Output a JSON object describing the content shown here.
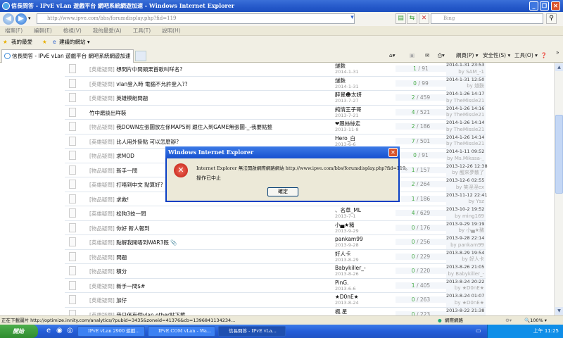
{
  "window": {
    "title": "信長問答 - IPvE vLan 遊戲平台 網吧系統網遊加速 - Windows Internet Explorer"
  },
  "address": {
    "url": "http://www.ipve.com/bbs/forumdisplay.php?fid=119",
    "search_placeholder": "Bing"
  },
  "menu": [
    "檔案(F)",
    "編輯(E)",
    "檢視(V)",
    "我的最愛(A)",
    "工具(T)",
    "說明(H)"
  ],
  "favorites": {
    "label": "我的最愛",
    "suggested": "建議的網站 ▾"
  },
  "tab": {
    "label": "信長問答 - IPvE vLan 遊戲平台 網吧系統網遊加速"
  },
  "commandbar": {
    "page": "網頁(P) ▾",
    "safety": "安全性(S) ▾",
    "tools": "工具(O) ▾"
  },
  "threads": [
    {
      "tag": "[英雄疑問]",
      "title": "想問片中間頭果首歌叫咩名?",
      "author": "燧麩",
      "date": "2014-1-31",
      "replies": "1",
      "views": "/ 91",
      "last_time": "2014-1-31 23:53",
      "last_by": "by SAM_-1"
    },
    {
      "tag": "[英雄疑問]",
      "title": "vlan登入時 電腦不允許登入??",
      "author": "燧麩",
      "date": "2014-1-31",
      "replies": "0",
      "views": "/ 99",
      "last_time": "2014-1-31 12:50",
      "last_by": "by 燧麩"
    },
    {
      "tag": "[英雄疑問]",
      "title": "英雄模組問題",
      "author": "醉覺☻太妍",
      "date": "2013-7-27",
      "replies": "2",
      "views": "/ 459",
      "last_time": "2014-1-26 14:17",
      "last_by": "by TheMissle21"
    },
    {
      "tag": "",
      "title": "竹中磨談出咩裝",
      "author": "純情王子哥",
      "date": "2013-7-21",
      "replies": "4",
      "views": "/ 521",
      "last_time": "2014-1-26 14:16",
      "last_by": "by TheMissle21"
    },
    {
      "tag": "[物品疑問]",
      "title": "我DOWN左張圖放左係MAPS到 跟住入到GAME無張圖-_-我要點整",
      "author": "❤跟絲絲走",
      "date": "2013-11-8",
      "replies": "2",
      "views": "/ 186",
      "last_time": "2014-1-26 14:14",
      "last_by": "by TheMissle21"
    },
    {
      "tag": "[英雄疑問]",
      "title": "比人用外掛點 可以怎麼辦?",
      "author": "Hero_白",
      "date": "2013-6-6",
      "replies": "7",
      "views": "/ 501",
      "last_time": "2014-1-26 14:14",
      "last_by": "by TheMissle21"
    },
    {
      "tag": "[物品疑問]",
      "title": "求MOD",
      "author": "",
      "date": "",
      "replies": "0",
      "views": "/ 91",
      "last_time": "2014-1-11 09:52",
      "last_by": "by Ms.Mikasa-_"
    },
    {
      "tag": "[物品疑問]",
      "title": "新手一問",
      "author": "",
      "date": "",
      "replies": "1",
      "views": "/ 157",
      "last_time": "2013-12-26 12:38",
      "last_by": "by 醒來夢散了"
    },
    {
      "tag": "[英雄疑問]",
      "title": "打唔到中文 點算好?",
      "author": "",
      "date": "",
      "replies": "2",
      "views": "/ 264",
      "last_time": "2013-12-6 02:55",
      "last_by": "by 笑淫淫ex"
    },
    {
      "tag": "[物品疑問]",
      "title": "求救!",
      "author": "",
      "date": "",
      "replies": "1",
      "views": "/ 186",
      "last_time": "2013-11-12 22:41",
      "last_by": "by Ysz"
    },
    {
      "tag": "[英雄疑問]",
      "title": "松狗3技一問",
      "author": "、名草_ML",
      "date": "2013-7-1",
      "replies": "4",
      "views": "/ 629",
      "last_time": "2013-10-2 19:52",
      "last_by": "by ming169"
    },
    {
      "tag": "[物品疑問]",
      "title": "你好 新人報到",
      "author": "小▄★豬",
      "date": "2013-9-29",
      "replies": "0",
      "views": "/ 176",
      "last_time": "2013-9-29 19:19",
      "last_by": "by 小▄★豬"
    },
    {
      "tag": "[英雄疑問]",
      "title": "點解我開唔到WAR3既 📎",
      "author": "pankam99",
      "date": "2013-9-28",
      "replies": "0",
      "views": "/ 256",
      "last_time": "2013-9-28 22:14",
      "last_by": "by pankam99"
    },
    {
      "tag": "[物品疑問]",
      "title": "問題",
      "author": "好人卡",
      "date": "2013-8-29",
      "replies": "0",
      "views": "/ 229",
      "last_time": "2013-8-29 19:54",
      "last_by": "by 好人卡"
    },
    {
      "tag": "[物品疑問]",
      "title": "積分",
      "author": "Babykiller_-",
      "date": "2013-8-26",
      "replies": "0",
      "views": "/ 220",
      "last_time": "2013-8-26 21:05",
      "last_by": "by Babykiller_-"
    },
    {
      "tag": "[英雄疑問]",
      "title": "新手一問$#",
      "author": "PinG.",
      "date": "2013-6-6",
      "replies": "1",
      "views": "/ 405",
      "last_time": "2013-8-24 20:22",
      "last_by": "by ★D0nE★"
    },
    {
      "tag": "[英雄疑問]",
      "title": "加仔",
      "author": "★D0nE★",
      "date": "2013-8-24",
      "replies": "0",
      "views": "/ 263",
      "last_time": "2013-8-24 01:07",
      "last_by": "by ★D0nE★"
    },
    {
      "tag": "[英雄疑問]",
      "title": "我只係有個vlan other點下載",
      "author": "楓.星",
      "date": "",
      "replies": "0",
      "views": "/ 223",
      "last_time": "2013-8-22 21:38",
      "last_by": ""
    }
  ],
  "dialog": {
    "title": "Windows Internet Explorer",
    "message": "Internet Explorer 無法開啟網際網路網站 http://www.ipve.com/bbs/forumdisplay.php?fid=119。",
    "message2": "操作已中止",
    "ok": "確定"
  },
  "status": {
    "text": "正在下載圖片 http://optimize.innity.com/analytics/?pubid=3435&zoneid=41376&cb=1396841134234...",
    "zone": "網際網路",
    "zoom": "100%"
  },
  "taskbar": {
    "start": "開始",
    "tasks": [
      "IPvE vLan 2900 遊戲...",
      "IPvE.COM vLan - Wa...",
      "信長問答 - IPvE vLa..."
    ],
    "clock": "上午 11:25"
  },
  "colors": {
    "titlebar": "#2458c9",
    "reply_count": "#44aa44",
    "taskbar": "#245dd8"
  }
}
